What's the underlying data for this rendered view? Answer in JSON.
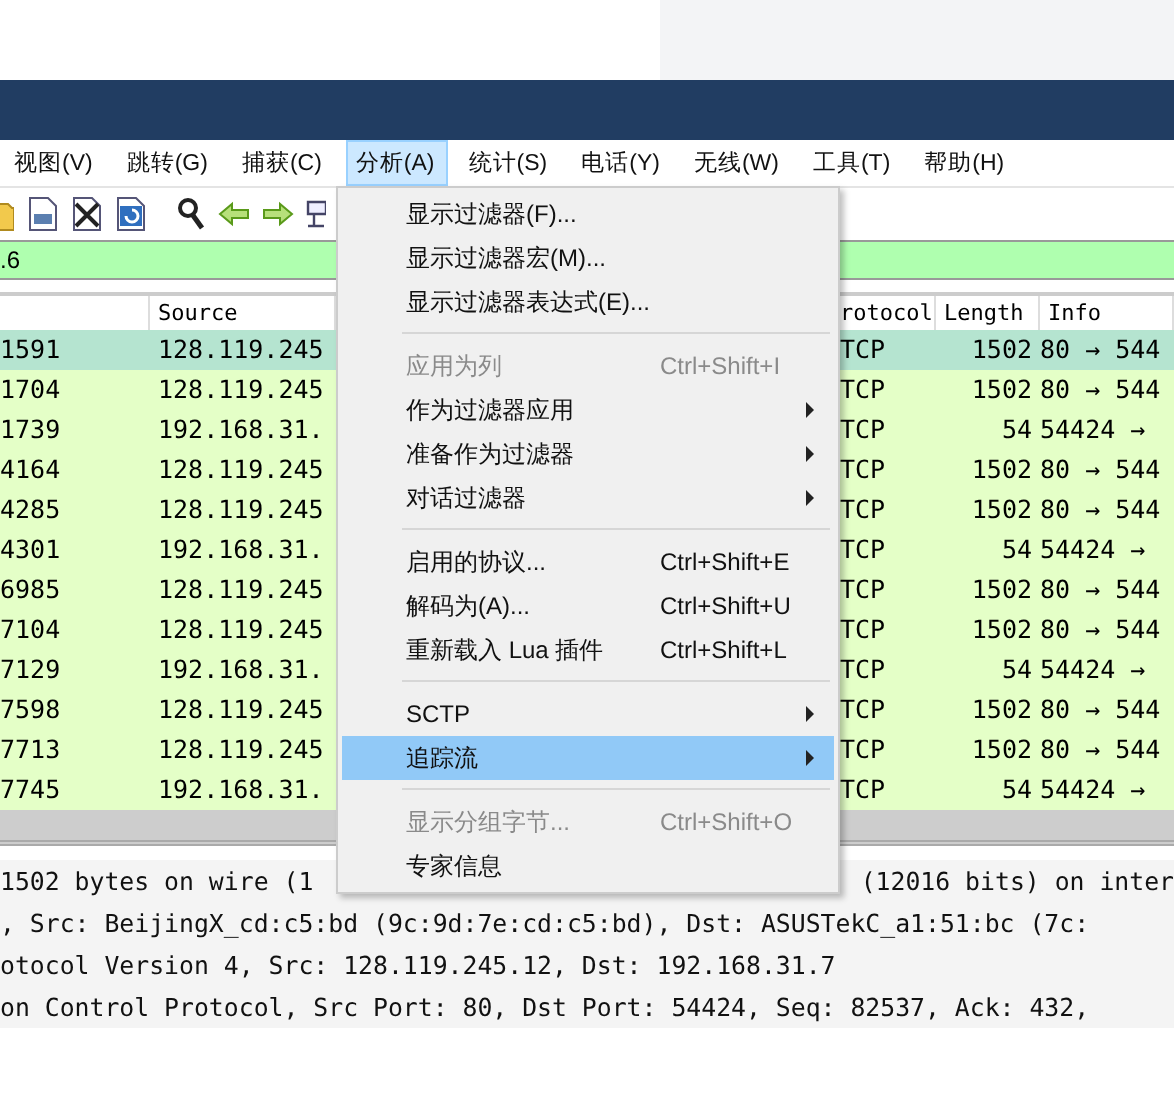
{
  "menu_bar": [
    {
      "label": "视图(V)",
      "selected": false
    },
    {
      "label": "跳转(G)",
      "selected": false
    },
    {
      "label": "捕获(C)",
      "selected": false
    },
    {
      "label": "分析(A)",
      "selected": true
    },
    {
      "label": "统计(S)",
      "selected": false
    },
    {
      "label": "电话(Y)",
      "selected": false
    },
    {
      "label": "无线(W)",
      "selected": false
    },
    {
      "label": "工具(T)",
      "selected": false
    },
    {
      "label": "帮助(H)",
      "selected": false
    }
  ],
  "filter": {
    "value": ".6"
  },
  "packet_list": {
    "columns": [
      "Source",
      "rotocol",
      "Length",
      "Info"
    ],
    "rows": [
      {
        "column_1": "1591",
        "source": "128.119.245",
        "protocol": "TCP",
        "length": "1502",
        "info": "80 → 544",
        "selected": true
      },
      {
        "column_1": "1704",
        "source": "128.119.245",
        "protocol": "TCP",
        "length": "1502",
        "info": "80 → 544",
        "selected": false
      },
      {
        "column_1": "1739",
        "source": "192.168.31.",
        "protocol": "TCP",
        "length": "54",
        "info": "54424 →",
        "selected": false
      },
      {
        "column_1": "4164",
        "source": "128.119.245",
        "protocol": "TCP",
        "length": "1502",
        "info": "80 → 544",
        "selected": false
      },
      {
        "column_1": "4285",
        "source": "128.119.245",
        "protocol": "TCP",
        "length": "1502",
        "info": "80 → 544",
        "selected": false
      },
      {
        "column_1": "4301",
        "source": "192.168.31.",
        "protocol": "TCP",
        "length": "54",
        "info": "54424 →",
        "selected": false
      },
      {
        "column_1": "6985",
        "source": "128.119.245",
        "protocol": "TCP",
        "length": "1502",
        "info": "80 → 544",
        "selected": false
      },
      {
        "column_1": "7104",
        "source": "128.119.245",
        "protocol": "TCP",
        "length": "1502",
        "info": "80 → 544",
        "selected": false
      },
      {
        "column_1": "7129",
        "source": "192.168.31.",
        "protocol": "TCP",
        "length": "54",
        "info": "54424 →",
        "selected": false
      },
      {
        "column_1": "7598",
        "source": "128.119.245",
        "protocol": "TCP",
        "length": "1502",
        "info": "80 → 544",
        "selected": false
      },
      {
        "column_1": "7713",
        "source": "128.119.245",
        "protocol": "TCP",
        "length": "1502",
        "info": "80 → 544",
        "selected": false
      },
      {
        "column_1": "7745",
        "source": "192.168.31.",
        "protocol": "TCP",
        "length": "54",
        "info": "54424 →",
        "selected": false
      }
    ]
  },
  "analyze_menu": [
    {
      "kind": "item",
      "label": "显示过滤器(F)...",
      "disabled": false,
      "submenu": false,
      "selected": false
    },
    {
      "kind": "item",
      "label": "显示过滤器宏(M)...",
      "disabled": false,
      "submenu": false,
      "selected": false
    },
    {
      "kind": "item",
      "label": "显示过滤器表达式(E)...",
      "disabled": false,
      "submenu": false,
      "selected": false
    },
    {
      "kind": "separator"
    },
    {
      "kind": "item",
      "label": "应用为列",
      "shortcut": "Ctrl+Shift+I",
      "disabled": true,
      "submenu": false,
      "selected": false
    },
    {
      "kind": "item",
      "label": "作为过滤器应用",
      "disabled": false,
      "submenu": true,
      "selected": false
    },
    {
      "kind": "item",
      "label": "准备作为过滤器",
      "disabled": false,
      "submenu": true,
      "selected": false
    },
    {
      "kind": "item",
      "label": "对话过滤器",
      "disabled": false,
      "submenu": true,
      "selected": false
    },
    {
      "kind": "separator"
    },
    {
      "kind": "item",
      "label": "启用的协议...",
      "shortcut": "Ctrl+Shift+E",
      "disabled": false,
      "submenu": false,
      "selected": false
    },
    {
      "kind": "item",
      "label": "解码为(A)...",
      "shortcut": "Ctrl+Shift+U",
      "disabled": false,
      "submenu": false,
      "selected": false
    },
    {
      "kind": "item",
      "label": "重新载入 Lua 插件",
      "shortcut": "Ctrl+Shift+L",
      "disabled": false,
      "submenu": false,
      "selected": false
    },
    {
      "kind": "separator"
    },
    {
      "kind": "item",
      "label": "SCTP",
      "disabled": false,
      "submenu": true,
      "selected": false
    },
    {
      "kind": "item",
      "label": "追踪流",
      "disabled": false,
      "submenu": true,
      "selected": true
    },
    {
      "kind": "separator"
    },
    {
      "kind": "item",
      "label": "显示分组字节...",
      "shortcut": "Ctrl+Shift+O",
      "disabled": true,
      "submenu": false,
      "selected": false
    },
    {
      "kind": "item",
      "label": "专家信息",
      "disabled": false,
      "submenu": false,
      "selected": false
    }
  ],
  "packet_details": [
    [
      "1502 bytes on wire (1",
      "(12016 bits) on inter"
    ],
    [
      ", Src: BeijingX_cd:c5:bd (9c:9d:7e:cd:c5:bd), Dst: ASUSTekC_a1:51:bc (7c:"
    ],
    [
      "otocol Version 4, Src: 128.119.245.12, Dst: 192.168.31.7"
    ],
    [
      "on Control Protocol, Src Port: 80, Dst Port: 54424, Seq: 82537, Ack: 432,"
    ]
  ]
}
